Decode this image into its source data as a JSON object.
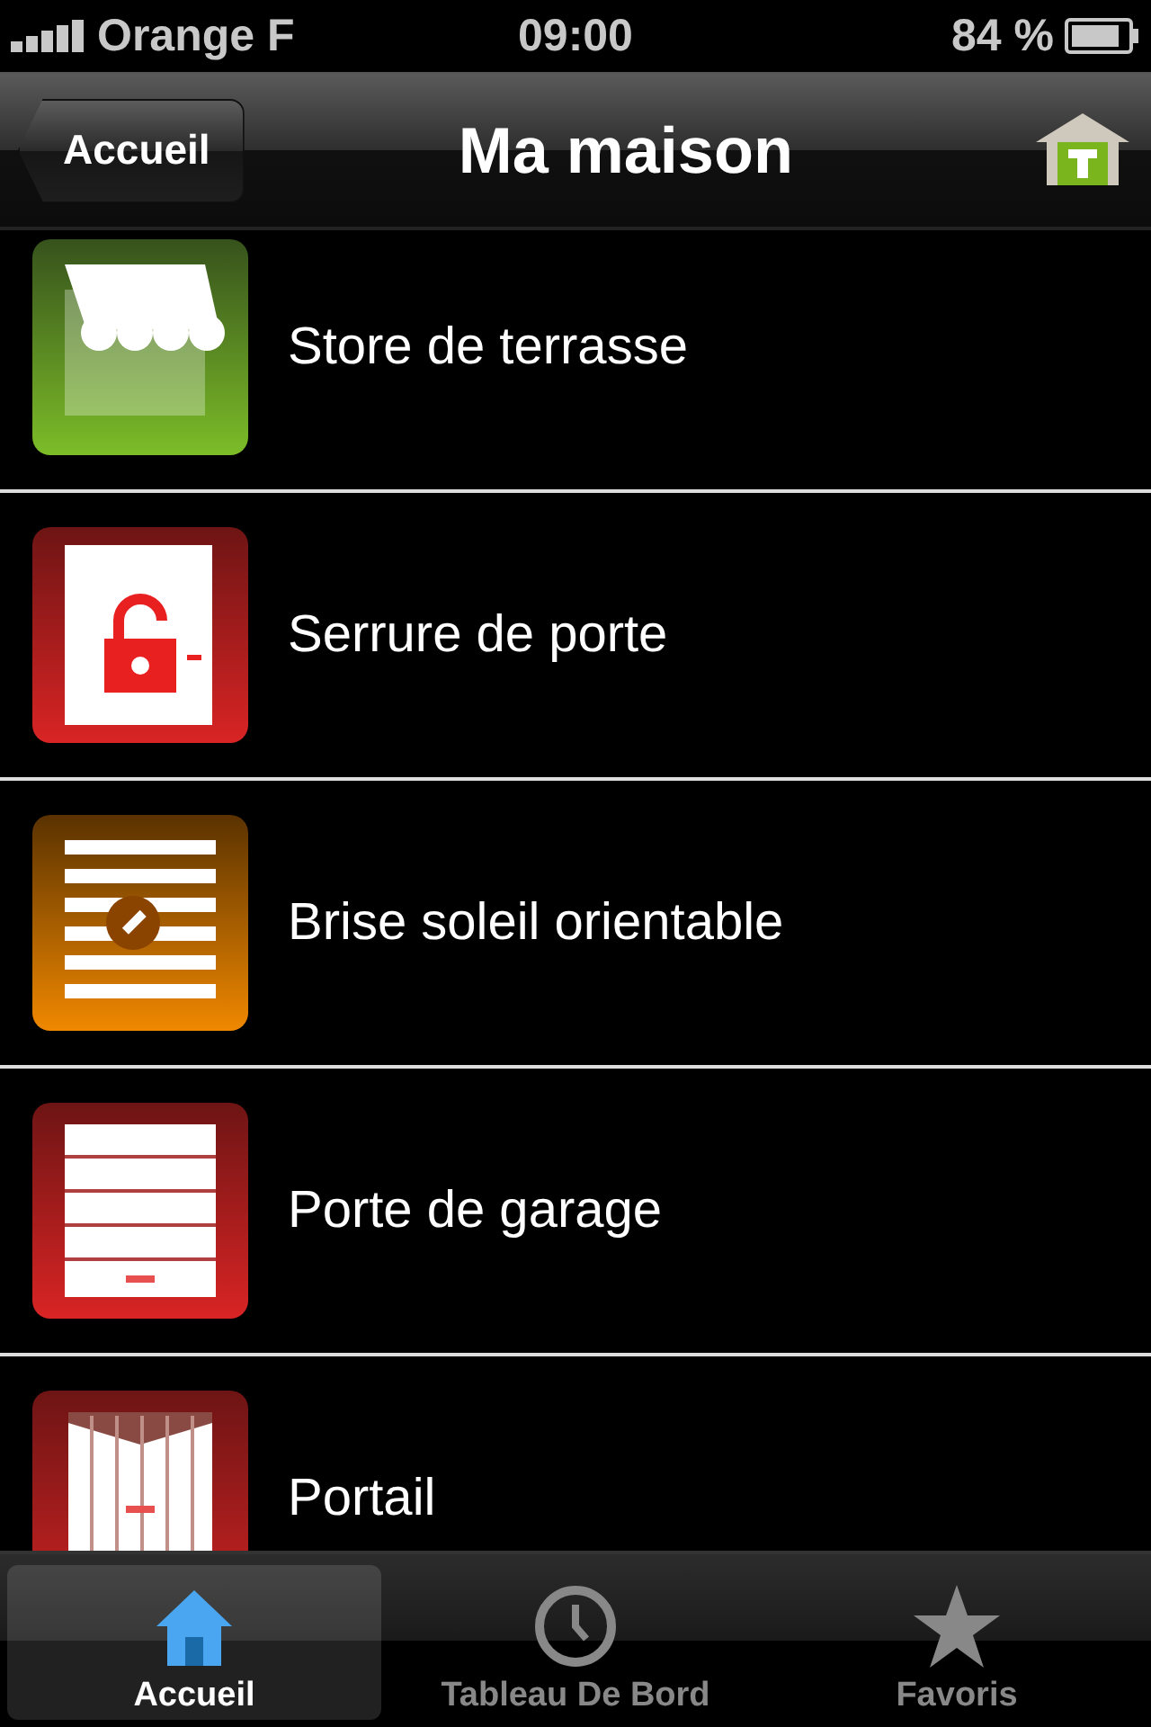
{
  "status_bar": {
    "carrier": "Orange F",
    "time": "09:00",
    "battery": "84 %"
  },
  "nav_bar": {
    "back": "Accueil",
    "title": "Ma maison"
  },
  "items": [
    {
      "kind": "awning",
      "label": "Store de terrasse"
    },
    {
      "kind": "lock",
      "label": "Serrure de porte"
    },
    {
      "kind": "blinds",
      "label": "Brise soleil orientable"
    },
    {
      "kind": "garage",
      "label": "Porte de garage"
    },
    {
      "kind": "gate",
      "label": "Portail"
    }
  ],
  "tabs": [
    {
      "kind": "home",
      "label": "Accueil",
      "selected": true
    },
    {
      "kind": "clock",
      "label": "Tableau De Bord",
      "selected": false
    },
    {
      "kind": "star",
      "label": "Favoris",
      "selected": false
    }
  ]
}
